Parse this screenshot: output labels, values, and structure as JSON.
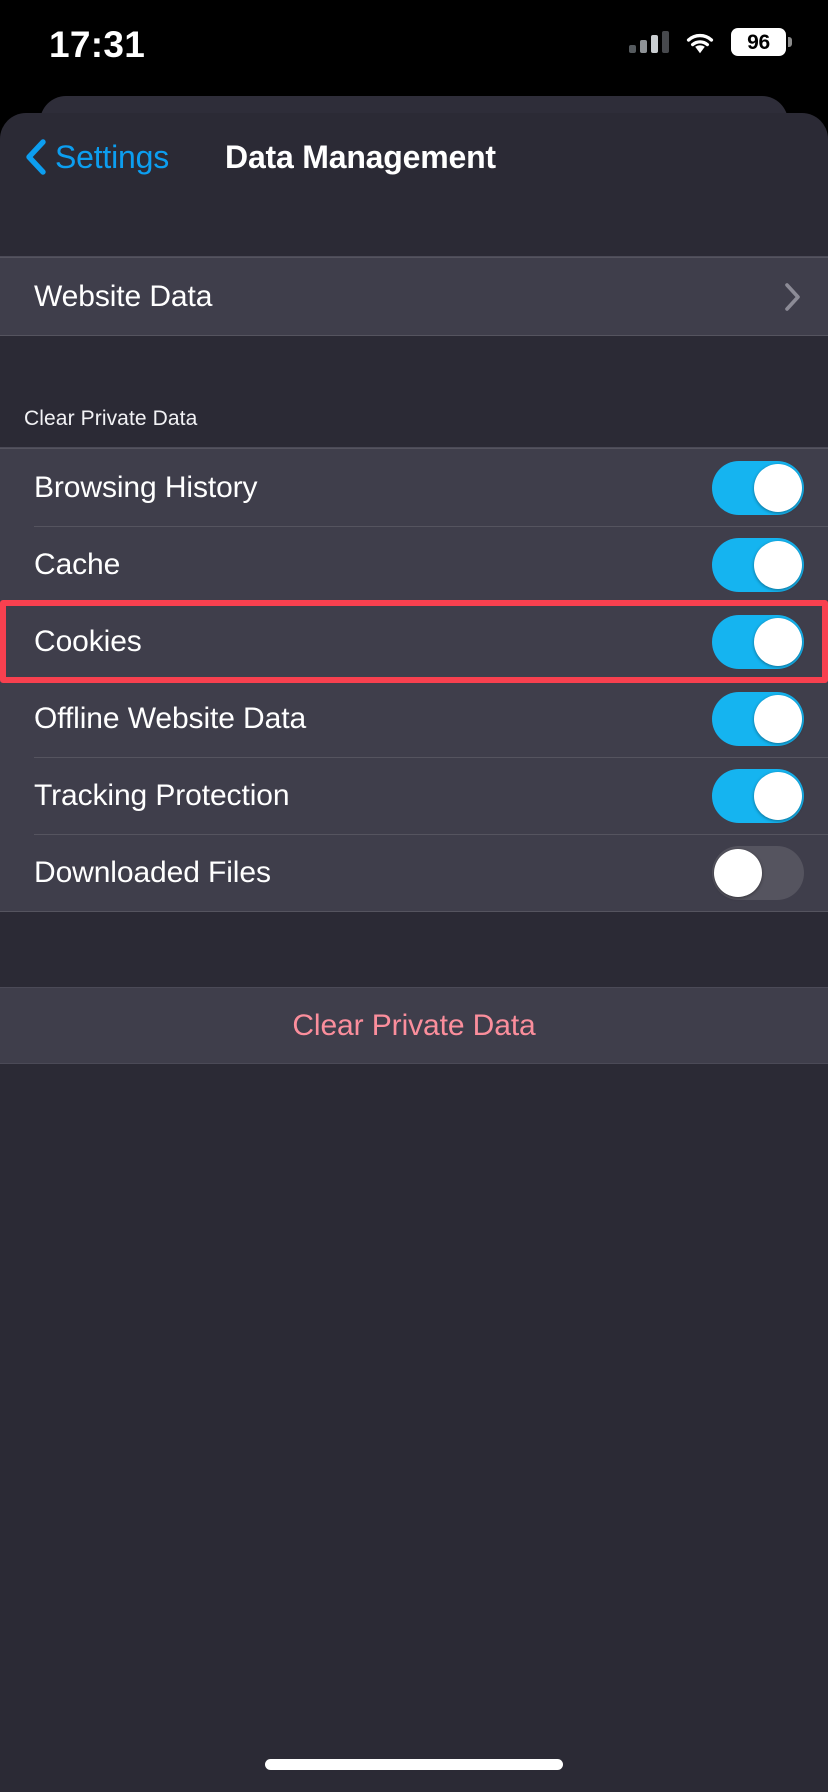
{
  "status_bar": {
    "time": "17:31",
    "battery_percent": "96",
    "signal_icon": "cellular-signal-icon",
    "wifi_icon": "wifi-icon",
    "battery_icon": "battery-icon"
  },
  "nav": {
    "back_label": "Settings",
    "back_icon": "chevron-left-icon",
    "title": "Data Management"
  },
  "website_data": {
    "label": "Website Data",
    "disclosure_icon": "chevron-right-icon"
  },
  "section": {
    "header": "Clear Private Data"
  },
  "toggles": [
    {
      "label": "Browsing History",
      "state": "on"
    },
    {
      "label": "Cache",
      "state": "on"
    },
    {
      "label": "Cookies",
      "state": "on"
    },
    {
      "label": "Offline Website Data",
      "state": "on"
    },
    {
      "label": "Tracking Protection",
      "state": "on"
    },
    {
      "label": "Downloaded Files",
      "state": "off"
    }
  ],
  "action": {
    "label": "Clear Private Data"
  },
  "highlight": {
    "target": "Cookies",
    "color": "#f8404f"
  },
  "colors": {
    "accent_blue": "#0c9ef0",
    "toggle_on": "#15b4f0",
    "toggle_off": "#55545f",
    "destructive": "#fb8e9c",
    "sheet_bg": "#2b2a35",
    "row_bg": "#3f3e4b",
    "separator": "#55545f"
  }
}
